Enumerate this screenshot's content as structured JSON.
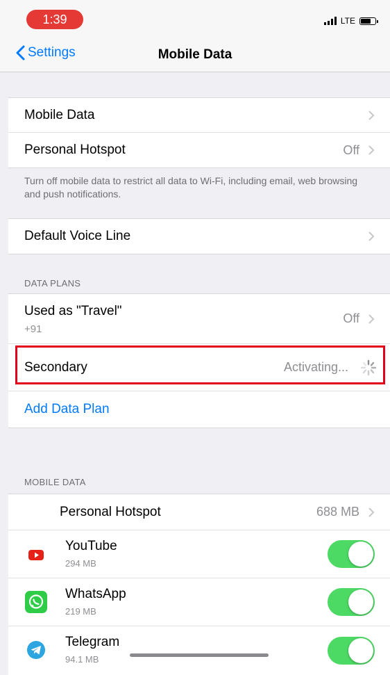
{
  "status_bar": {
    "time": "1:39",
    "network": "LTE",
    "battery_level": 0.6
  },
  "nav": {
    "back_label": "Settings",
    "title": "Mobile Data"
  },
  "main_settings": [
    {
      "label": "Mobile Data",
      "value": ""
    },
    {
      "label": "Personal Hotspot",
      "value": "Off"
    }
  ],
  "main_footnote": "Turn off mobile data to restrict all data to Wi-Fi, including email, web browsing and push notifications.",
  "voice_line": {
    "label": "Default Voice Line"
  },
  "data_plans": {
    "header": "DATA PLANS",
    "plans": [
      {
        "label": "Used as \"Travel\"",
        "sub": "+91",
        "value": "Off"
      },
      {
        "label": "Secondary",
        "value": "Activating..."
      }
    ],
    "add_label": "Add Data Plan"
  },
  "mobile_data": {
    "header": "MOBILE DATA",
    "hotspot": {
      "label": "Personal Hotspot",
      "value": "688 MB"
    },
    "apps": [
      {
        "name": "YouTube",
        "usage": "294 MB",
        "icon": "youtube-icon",
        "enabled": true
      },
      {
        "name": "WhatsApp",
        "usage": "219 MB",
        "icon": "whatsapp-icon",
        "enabled": true
      },
      {
        "name": "Telegram",
        "usage": "94.1 MB",
        "icon": "telegram-icon",
        "enabled": true
      }
    ]
  },
  "colors": {
    "accent": "#007aff",
    "toggle_on": "#4cd964",
    "highlight": "#e3001b",
    "time_pill": "#e53935"
  }
}
